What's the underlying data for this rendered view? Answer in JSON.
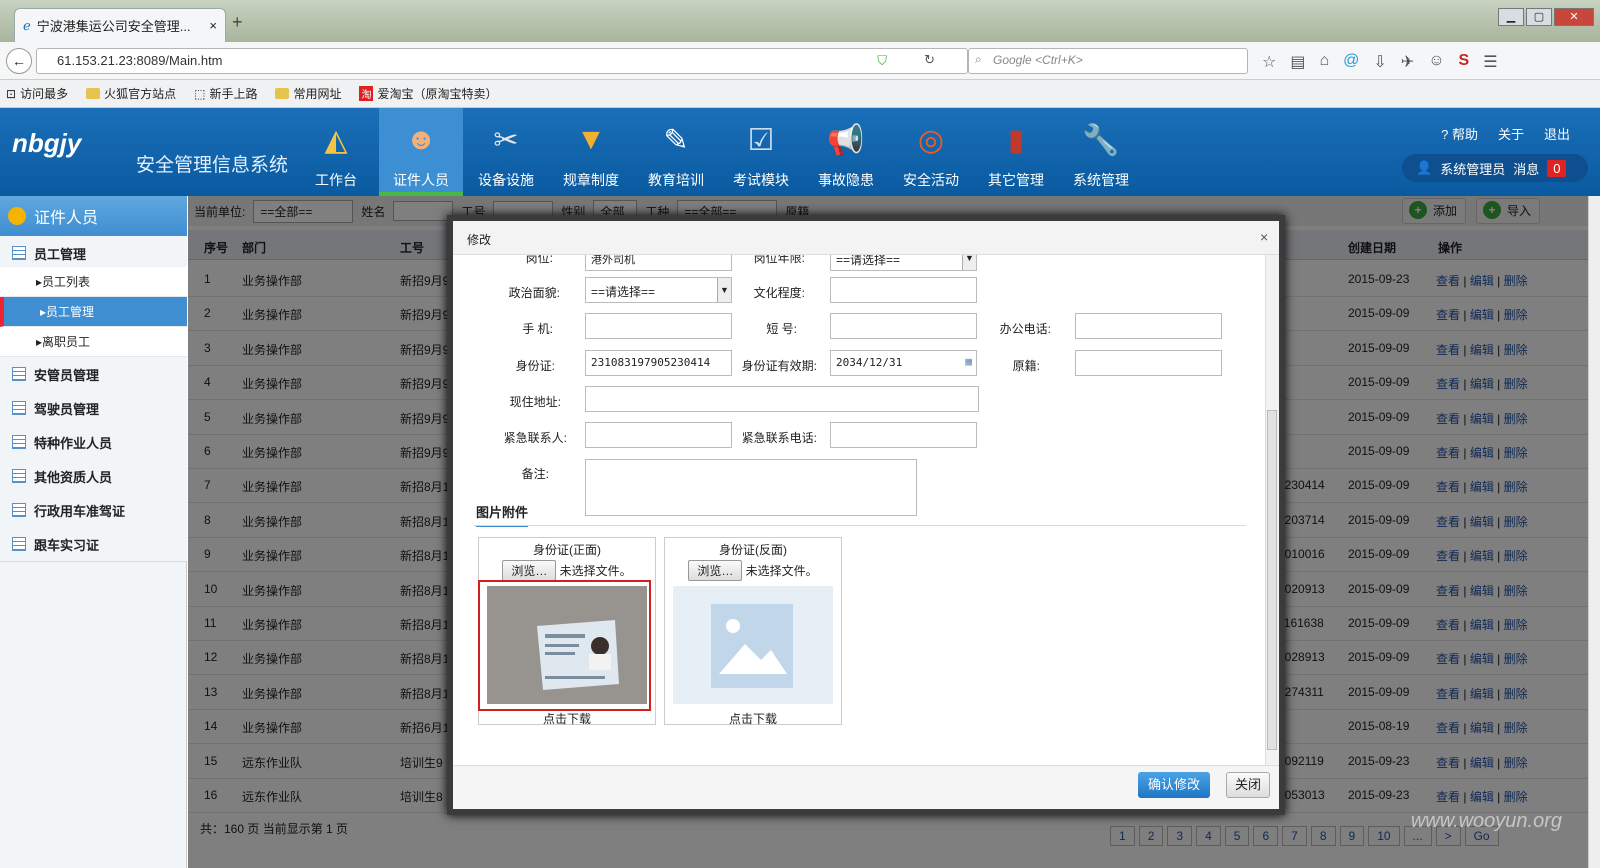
{
  "browser": {
    "tab_title": "宁波港集运公司安全管理...",
    "url": "61.153.21.23:8089/Main.htm",
    "search_placeholder": "Google <Ctrl+K>",
    "bookmarks": [
      "访问最多",
      "火狐官方站点",
      "新手上路",
      "常用网址",
      "爱淘宝（原淘宝特卖）"
    ]
  },
  "header": {
    "logo": "nbgjy",
    "system_title": "安全管理信息系统",
    "modules": [
      "工作台",
      "证件人员",
      "设备设施",
      "规章制度",
      "教育培训",
      "考试模块",
      "事故隐患",
      "安全活动",
      "其它管理",
      "系统管理"
    ],
    "active_module": "证件人员",
    "links": [
      "帮助",
      "关于",
      "退出"
    ],
    "user": "系统管理员",
    "messages_label": "消息",
    "messages_count": "0"
  },
  "sidebar": {
    "title": "证件人员",
    "groups": [
      "员工管理",
      "安管员管理",
      "驾驶员管理",
      "特种作业人员",
      "其他资质人员",
      "行政用车准驾证",
      "跟车实习证"
    ],
    "sub_items": [
      "员工列表",
      "员工管理",
      "离职员工"
    ],
    "selected_sub": "员工管理"
  },
  "filter": {
    "unit_label": "当前单位:",
    "unit_value": "==全部==",
    "name_label": "姓名",
    "id_label": "工号",
    "gender_label": "性别",
    "gender_value": "全部",
    "type_label": "工种",
    "type_value": "==全部==",
    "origin_label": "原籍",
    "add_label": "添加",
    "import_label": "导入"
  },
  "table": {
    "headers": {
      "no": "序号",
      "dept": "部门",
      "id": "工号",
      "created": "创建日期",
      "ops": "操作"
    },
    "ops": [
      "查看",
      "编辑",
      "删除"
    ],
    "rows": [
      {
        "no": "1",
        "dept": "业务操作部",
        "id": "新招9月95",
        "tail": "",
        "date": "2015-09-23"
      },
      {
        "no": "2",
        "dept": "业务操作部",
        "id": "新招9月95",
        "tail": "",
        "date": "2015-09-09"
      },
      {
        "no": "3",
        "dept": "业务操作部",
        "id": "新招9月95",
        "tail": "",
        "date": "2015-09-09"
      },
      {
        "no": "4",
        "dept": "业务操作部",
        "id": "新招9月95",
        "tail": "",
        "date": "2015-09-09"
      },
      {
        "no": "5",
        "dept": "业务操作部",
        "id": "新招9月95",
        "tail": "",
        "date": "2015-09-09"
      },
      {
        "no": "6",
        "dept": "业务操作部",
        "id": "新招9月95",
        "tail": "",
        "date": "2015-09-09"
      },
      {
        "no": "7",
        "dept": "业务操作部",
        "id": "新招8月19",
        "tail": "5230414",
        "date": "2015-09-09"
      },
      {
        "no": "8",
        "dept": "业务操作部",
        "id": "新招8月19",
        "tail": "3203714",
        "date": "2015-09-09"
      },
      {
        "no": "9",
        "dept": "业务操作部",
        "id": "新招8月19",
        "tail": "2010016",
        "date": "2015-09-09"
      },
      {
        "no": "10",
        "dept": "业务操作部",
        "id": "新招8月19",
        "tail": "2020913",
        "date": "2015-09-09"
      },
      {
        "no": "11",
        "dept": "业务操作部",
        "id": "新招8月19",
        "tail": "1161638",
        "date": "2015-09-09"
      },
      {
        "no": "12",
        "dept": "业务操作部",
        "id": "新招8月19",
        "tail": "9028913",
        "date": "2015-09-09"
      },
      {
        "no": "13",
        "dept": "业务操作部",
        "id": "新招8月19",
        "tail": "2274311",
        "date": "2015-09-09"
      },
      {
        "no": "14",
        "dept": "业务操作部",
        "id": "新招6月18",
        "tail": "",
        "date": "2015-08-19"
      },
      {
        "no": "15",
        "dept": "远东作业队",
        "id": "培训生9",
        "tail": "0092119",
        "date": "2015-09-23"
      },
      {
        "no": "16",
        "dept": "远东作业队",
        "id": "培训生8",
        "tail": "6053013",
        "date": "2015-09-23"
      }
    ],
    "footer": "共：160 页  当前显示第 1 页",
    "pages": [
      "1",
      "2",
      "3",
      "4",
      "5",
      "6",
      "7",
      "8",
      "9",
      "10",
      "...",
      ">",
      "Go"
    ]
  },
  "modal": {
    "title": "修改",
    "close": "×",
    "fields": {
      "post_label": "岗位:",
      "post_value": "港外司机",
      "post_years_label": "岗位年限:",
      "post_years_value": "==请选择==",
      "political_label": "政治面貌:",
      "political_value": "==请选择==",
      "education_label": "文化程度:",
      "mobile_label": "手  机:",
      "short_label": "短  号:",
      "office_label": "办公电话:",
      "idcard_label": "身份证:",
      "idcard_value": "231083197905230414",
      "idcard_exp_label": "身份证有效期:",
      "idcard_exp_value": "2034/12/31",
      "origin_label": "原籍:",
      "address_label": "现住地址:",
      "contact_label": "紧急联系人:",
      "contact_phone_label": "紧急联系电话:",
      "remark_label": "备注:"
    },
    "attachments_title": "图片附件",
    "cards": [
      {
        "title": "身份证(正面)",
        "browse": "浏览…",
        "nofile": "未选择文件。",
        "download": "点击下载"
      },
      {
        "title": "身份证(反面)",
        "browse": "浏览…",
        "nofile": "未选择文件。",
        "download": "点击下载"
      }
    ],
    "confirm": "确认修改",
    "close_btn": "关闭"
  },
  "watermark": "www.wooyun.org",
  "colors": {
    "brand": "#1a6fb8",
    "highlight": "#d21f1f",
    "active_tab_bar": "#4ab845"
  }
}
